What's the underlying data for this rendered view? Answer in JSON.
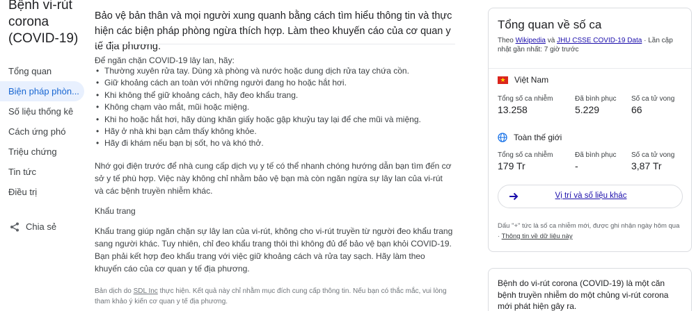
{
  "page_title": "Bệnh vi-rút corona (COVID-19)",
  "nav": {
    "items": [
      {
        "label": "Tổng quan"
      },
      {
        "label": "Biện pháp phòn..."
      },
      {
        "label": "Số liệu thống kê"
      },
      {
        "label": "Cách ứng phó"
      },
      {
        "label": "Triệu chứng"
      },
      {
        "label": "Tin tức"
      },
      {
        "label": "Điều trị"
      }
    ],
    "active_index": 1,
    "share_label": "Chia sẻ"
  },
  "article": {
    "intro": "Bảo vệ bản thân và mọi người xung quanh bằng cách tìm hiểu thông tin và thực hiện các biện pháp phòng ngừa thích hợp. Làm theo khuyến cáo của cơ quan y tế địa phương.",
    "howto_heading": "Để ngăn chặn COVID-19 lây lan, hãy:",
    "bullets": [
      "Thường xuyên rửa tay. Dùng xà phòng và nước hoặc dung dịch rửa tay chứa cồn.",
      "Giữ khoảng cách an toàn với những người đang ho hoặc hắt hơi.",
      "Khi không thể giữ khoảng cách, hãy đeo khẩu trang.",
      "Không chạm vào mắt, mũi hoặc miệng.",
      "Khi ho hoặc hắt hơi, hãy dùng khăn giấy hoặc gập khuỷu tay lại để che mũi và miệng.",
      "Hãy ở nhà khi bạn cảm thấy không khỏe.",
      "Hãy đi khám nếu bạn bị sốt, ho và khó thở."
    ],
    "para1": "Nhớ gọi điện trước để nhà cung cấp dịch vụ y tế có thể nhanh chóng hướng dẫn bạn tìm đến cơ sở y tế phù hợp. Việc này không chỉ nhằm bảo vệ bạn mà còn ngăn ngừa sự lây lan của vi-rút và các bệnh truyền nhiễm khác.",
    "mask_heading": "Khẩu trang",
    "para2": "Khẩu trang giúp ngăn chặn sự lây lan của vi-rút, không cho vi-rút truyền từ người đeo khẩu trang sang người khác. Tuy nhiên, chỉ đeo khẩu trang thôi thì không đủ để bảo vệ bạn khỏi COVID-19. Bạn phải kết hợp đeo khẩu trang với việc giữ khoảng cách và rửa tay sạch. Hãy làm theo khuyến cáo của cơ quan y tế địa phương.",
    "footnote_prefix": "Bản dịch do ",
    "footnote_link": "SDL Inc",
    "footnote_suffix": " thực hiện. Kết quả này chỉ nhằm mục đích cung cấp thông tin. Nếu bạn có thắc mắc, vui lòng tham khảo ý kiến cơ quan y tế địa phương."
  },
  "stats_card": {
    "title": "Tổng quan về số ca",
    "source_prefix": "Theo ",
    "source_link1": "Wikipedia",
    "source_and": " và ",
    "source_link2": "JHU CSSE COVID-19 Data",
    "source_suffix": " · Lần cập nhật gần nhất: 7 giờ trước",
    "regions": [
      {
        "name": "Việt Nam",
        "icon": "vietnam-flag-icon",
        "labels": [
          "Tổng số ca nhiễm",
          "Đã bình phục",
          "Số ca tử vong"
        ],
        "values": [
          "13.258",
          "5.229",
          "66"
        ]
      },
      {
        "name": "Toàn thế giới",
        "icon": "globe-icon",
        "labels": [
          "Tổng số ca nhiễm",
          "Đã bình phục",
          "Số ca tử vong"
        ],
        "values": [
          "179 Tr",
          "-",
          "3,87 Tr"
        ]
      }
    ],
    "more_label": "Vị trí và số liệu khác",
    "footer_text": "Dấu \"+\" tức là số ca nhiễm mới, được ghi nhận ngày hôm qua · ",
    "footer_link": "Thông tin về dữ liệu này",
    "colors": {
      "link": "#1a0dab",
      "flag_red": "#da251d",
      "flag_star": "#ffde00",
      "arrow": "#1a0dab"
    }
  },
  "info_card": {
    "text": "Bệnh do vi-rút corona (COVID-19) là một căn bệnh truyền nhiễm do một chủng vi-rút corona mới phát hiện gây ra."
  }
}
